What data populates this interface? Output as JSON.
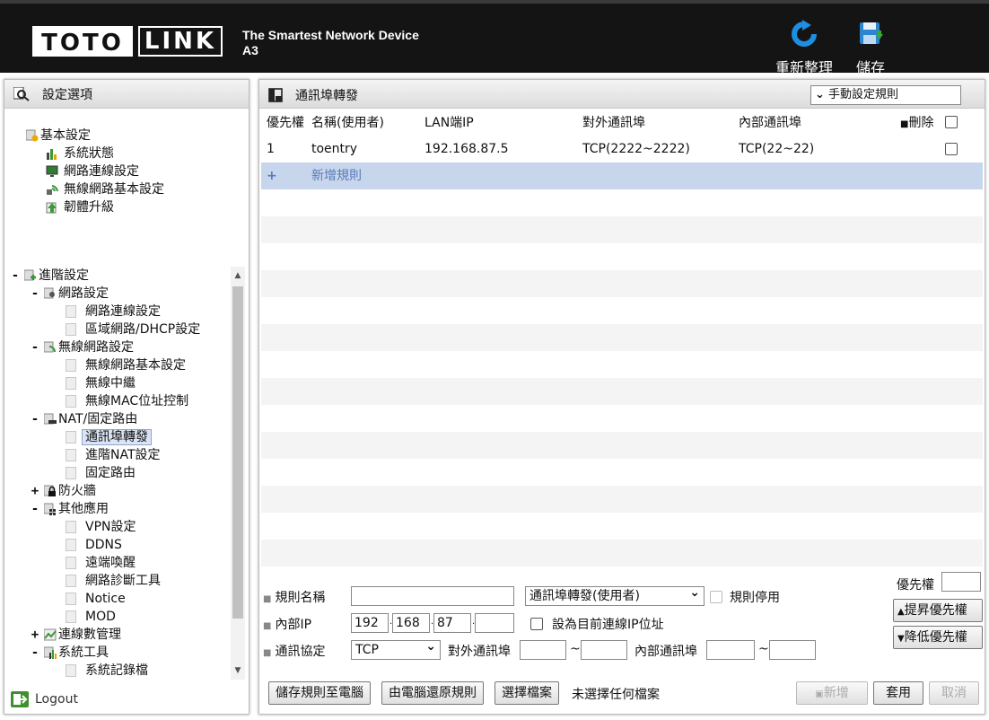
{
  "header": {
    "logo_left": "TOTO",
    "logo_right": "LINK",
    "tagline": "The Smartest Network Device",
    "model": "A3",
    "refresh_label": "重新整理",
    "save_label": "儲存"
  },
  "sidebar": {
    "title": "設定選項",
    "basic": {
      "label": "基本設定",
      "items": [
        "系統狀態",
        "網路連線設定",
        "無線網路基本設定",
        "韌體升級"
      ]
    },
    "advanced": {
      "label": "進階設定",
      "network": {
        "label": "網路設定",
        "items": [
          "網路連線設定",
          "區域網路/DHCP設定"
        ]
      },
      "wireless": {
        "label": "無線網路設定",
        "items": [
          "無線網路基本設定",
          "無線中繼",
          "無線MAC位址控制"
        ]
      },
      "nat": {
        "label": "NAT/固定路由",
        "items": [
          "通訊埠轉發",
          "進階NAT設定",
          "固定路由"
        ]
      },
      "firewall": {
        "label": "防火牆"
      },
      "other": {
        "label": "其他應用",
        "items": [
          "VPN設定",
          "DDNS",
          "遠端喚醒",
          "網路診斷工具",
          "Notice",
          "MOD"
        ]
      },
      "traffic": {
        "label": "連線數管理"
      },
      "tools": {
        "label": "系統工具",
        "items": [
          "系統記錄檔"
        ]
      }
    },
    "logout": "Logout"
  },
  "main": {
    "title": "通訊埠轉發",
    "mode_select": "手動設定規則",
    "columns": {
      "priority": "優先權",
      "name": "名稱(使用者)",
      "lan_ip": "LAN端IP",
      "ext_port": "對外通訊埠",
      "int_port": "內部通訊埠",
      "delete": "刪除"
    },
    "rows": [
      {
        "priority": "1",
        "name": "toentry",
        "lan_ip": "192.168.87.5",
        "ext_port": "TCP(2222~2222)",
        "int_port": "TCP(22~22)"
      }
    ],
    "add_rule": "新增規則",
    "form": {
      "rule_name_label": "規則名稱",
      "rule_name_value": "",
      "rule_type_value": "通訊埠轉發(使用者)",
      "disable_label": "規則停用",
      "internal_ip_label": "內部IP",
      "ip": [
        "192",
        "168",
        "87",
        ""
      ],
      "set_current_ip_label": "設為目前連線IP位址",
      "protocol_label": "通訊協定",
      "protocol_value": "TCP",
      "ext_port_label": "對外通訊埠",
      "int_port_label": "內部通訊埠",
      "tilde": "~",
      "priority_label": "優先權",
      "priority_value": "",
      "raise_priority": "提昇優先權",
      "lower_priority": "降低優先權"
    },
    "buttons": {
      "save_rules": "儲存規則至電腦",
      "restore_rules": "由電腦還原規則",
      "choose_file": "選擇檔案",
      "no_file": "未選擇任何檔案",
      "add": "新增",
      "apply": "套用",
      "cancel": "取消"
    }
  }
}
